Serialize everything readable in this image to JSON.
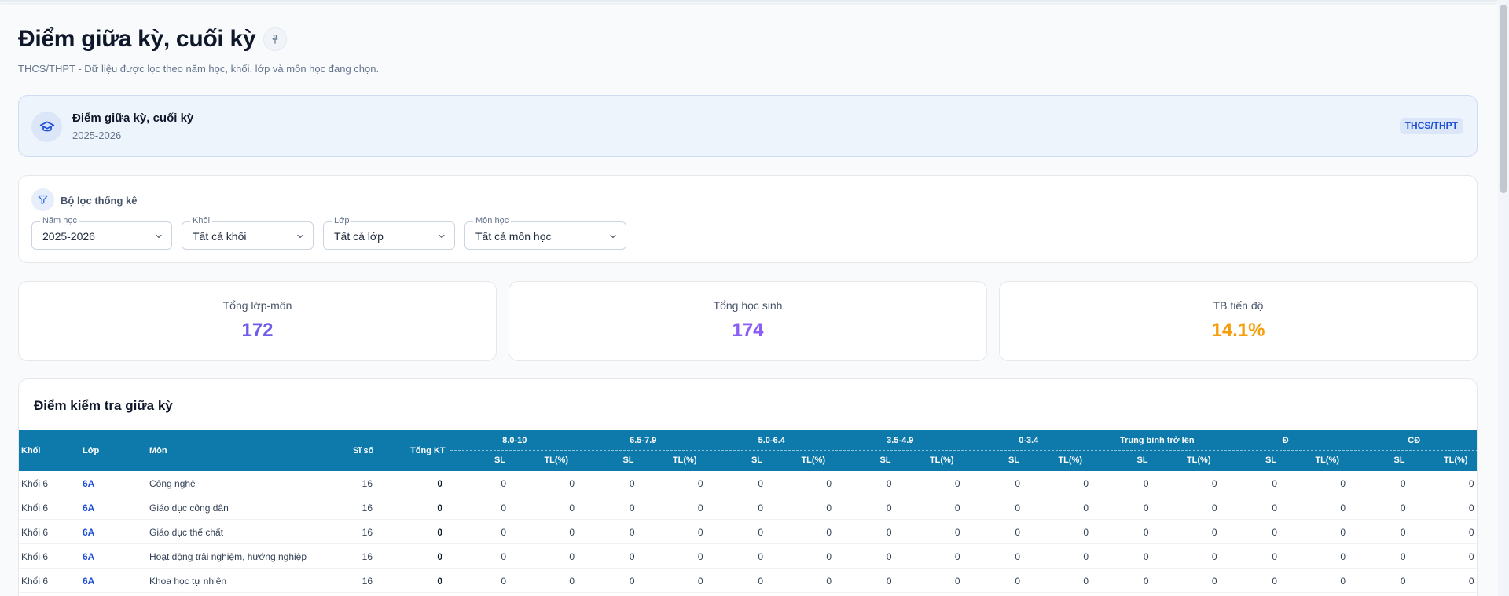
{
  "page": {
    "title": "Điểm giữa kỳ, cuối kỳ",
    "pin_icon": "📌",
    "subtitle": "THCS/THPT - Dữ liệu được lọc theo năm học, khối, lớp và môn học đang chọn."
  },
  "info_card": {
    "title": "Điểm giữa kỳ, cuối kỳ",
    "year": "2025-2026",
    "badge": "THCS/THPT",
    "icon": "graduation-cap-icon"
  },
  "filters": {
    "title": "Bộ lọc thống kê",
    "icon": "filter-icon",
    "school_year": {
      "label": "Năm học",
      "value": "2025-2026"
    },
    "grade": {
      "label": "Khối",
      "value": "Tất cả khối"
    },
    "class": {
      "label": "Lớp",
      "value": "Tất cả lớp"
    },
    "subject": {
      "label": "Môn học",
      "value": "Tất cả môn học"
    }
  },
  "stats": [
    {
      "label": "Tổng lớp-môn",
      "value": "172",
      "color": "#6d5de8"
    },
    {
      "label": "Tổng học sinh",
      "value": "174",
      "color": "#8b5cf6"
    },
    {
      "label": "TB tiến độ",
      "value": "14.1%",
      "color": "#f59e0b"
    }
  ],
  "midterm_table": {
    "title": "Điểm kiểm tra giữa kỳ",
    "header_color": "#0e7aab",
    "columns": {
      "grade": "Khối",
      "class": "Lớp",
      "subject": "Môn",
      "size": "Sĩ số",
      "total": "Tổng KT",
      "sl": "SL",
      "tl": "TL(%)"
    },
    "groups": [
      "8.0-10",
      "6.5-7.9",
      "5.0-6.4",
      "3.5-4.9",
      "0-3.4",
      "Trung bình trở lên",
      "Đ",
      "CĐ"
    ],
    "rows": [
      {
        "grade": "Khối 6",
        "class": "6A",
        "subject": "Công nghệ",
        "size": "16",
        "total": "0",
        "cells": [
          "0",
          "0",
          "0",
          "0",
          "0",
          "0",
          "0",
          "0",
          "0",
          "0",
          "0",
          "0",
          "0",
          "0",
          "0",
          "0"
        ]
      },
      {
        "grade": "Khối 6",
        "class": "6A",
        "subject": "Giáo dục công dân",
        "size": "16",
        "total": "0",
        "cells": [
          "0",
          "0",
          "0",
          "0",
          "0",
          "0",
          "0",
          "0",
          "0",
          "0",
          "0",
          "0",
          "0",
          "0",
          "0",
          "0"
        ]
      },
      {
        "grade": "Khối 6",
        "class": "6A",
        "subject": "Giáo dục thể chất",
        "size": "16",
        "total": "0",
        "cells": [
          "0",
          "0",
          "0",
          "0",
          "0",
          "0",
          "0",
          "0",
          "0",
          "0",
          "0",
          "0",
          "0",
          "0",
          "0",
          "0"
        ]
      },
      {
        "grade": "Khối 6",
        "class": "6A",
        "subject": "Hoạt động trải nghiệm, hướng nghiệp",
        "size": "16",
        "total": "0",
        "cells": [
          "0",
          "0",
          "0",
          "0",
          "0",
          "0",
          "0",
          "0",
          "0",
          "0",
          "0",
          "0",
          "0",
          "0",
          "0",
          "0"
        ]
      },
      {
        "grade": "Khối 6",
        "class": "6A",
        "subject": "Khoa học tự nhiên",
        "size": "16",
        "total": "0",
        "cells": [
          "0",
          "0",
          "0",
          "0",
          "0",
          "0",
          "0",
          "0",
          "0",
          "0",
          "0",
          "0",
          "0",
          "0",
          "0",
          "0"
        ]
      }
    ]
  }
}
